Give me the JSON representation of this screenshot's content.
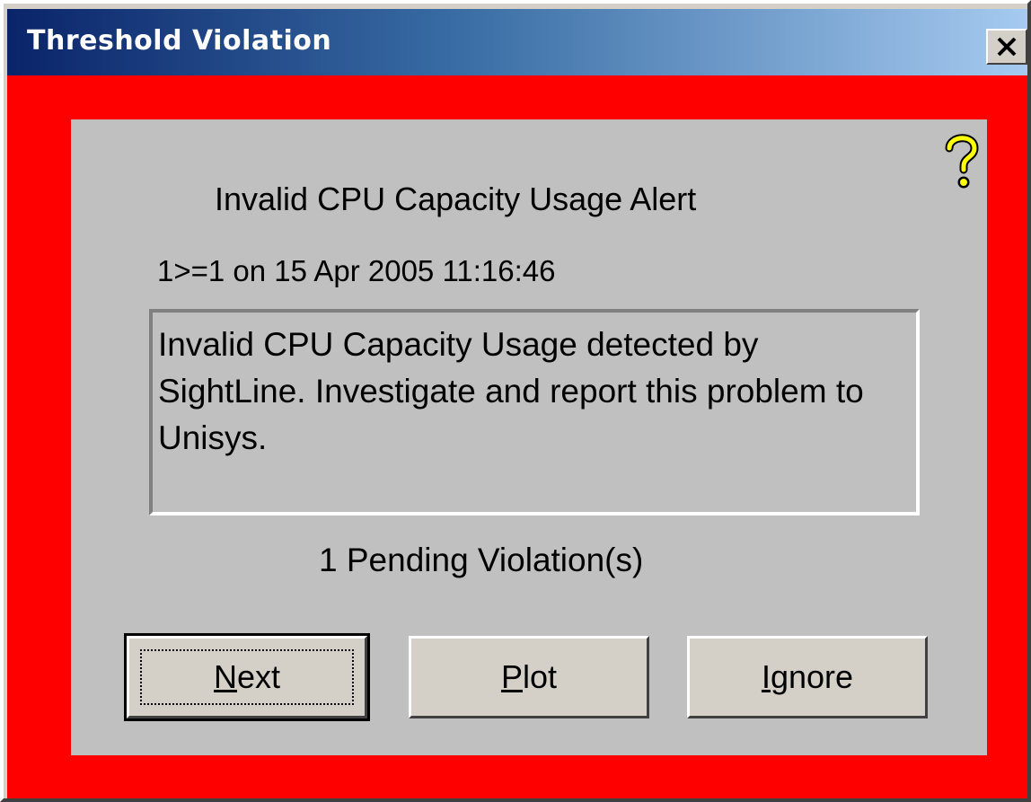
{
  "window": {
    "title": "Threshold Violation",
    "close_label": "X"
  },
  "alert": {
    "title": "Invalid CPU Capacity Usage Alert",
    "condition": "1>=1 on 15 Apr 2005 11:16:46",
    "message": "Invalid CPU Capacity Usage detected by SightLine.   Investigate and report this problem to Unisys.",
    "pending": "1  Pending Violation(s)"
  },
  "buttons": {
    "next": {
      "accel": "N",
      "rest": "ext"
    },
    "plot": {
      "accel": "P",
      "rest": "lot"
    },
    "ignore": {
      "accel": "I",
      "rest": "gnore"
    }
  },
  "colors": {
    "alert_background": "#ff0000",
    "panel": "#c0c0c0",
    "titlebar_start": "#0a246a",
    "titlebar_end": "#a6caf0"
  },
  "icons": {
    "help": "help-question-icon",
    "close": "close-icon"
  }
}
